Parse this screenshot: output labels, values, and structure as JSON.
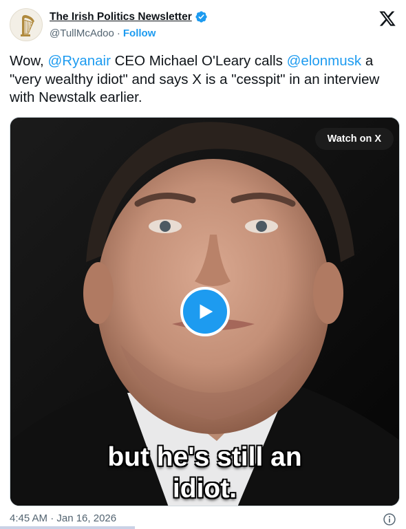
{
  "author": {
    "name": "The Irish Politics Newsletter",
    "handle": "@TullMcAdoo",
    "separator": "·",
    "follow_label": "Follow",
    "verified_icon": "verified-badge-icon",
    "avatar_icon": "harp-icon"
  },
  "tweet": {
    "segments": [
      {
        "type": "text",
        "text": "Wow, "
      },
      {
        "type": "mention",
        "text": "@Ryanair"
      },
      {
        "type": "text",
        "text": " CEO Michael O'Leary calls "
      },
      {
        "type": "mention",
        "text": "@elonmusk"
      },
      {
        "type": "text",
        "text": " a \"very wealthy idiot\" and says X is a \"cesspit\" in an interview with Newstalk earlier."
      }
    ]
  },
  "media": {
    "watch_label": "Watch on X",
    "caption_line1": "but he's still an",
    "caption_line2": "idiot.",
    "play_icon": "play-icon"
  },
  "footer": {
    "timestamp": "4:45 AM · Jan 16, 2026",
    "info_icon": "info-icon"
  },
  "colors": {
    "accent": "#1d9bf0",
    "text": "#0f1419",
    "muted": "#536471"
  }
}
